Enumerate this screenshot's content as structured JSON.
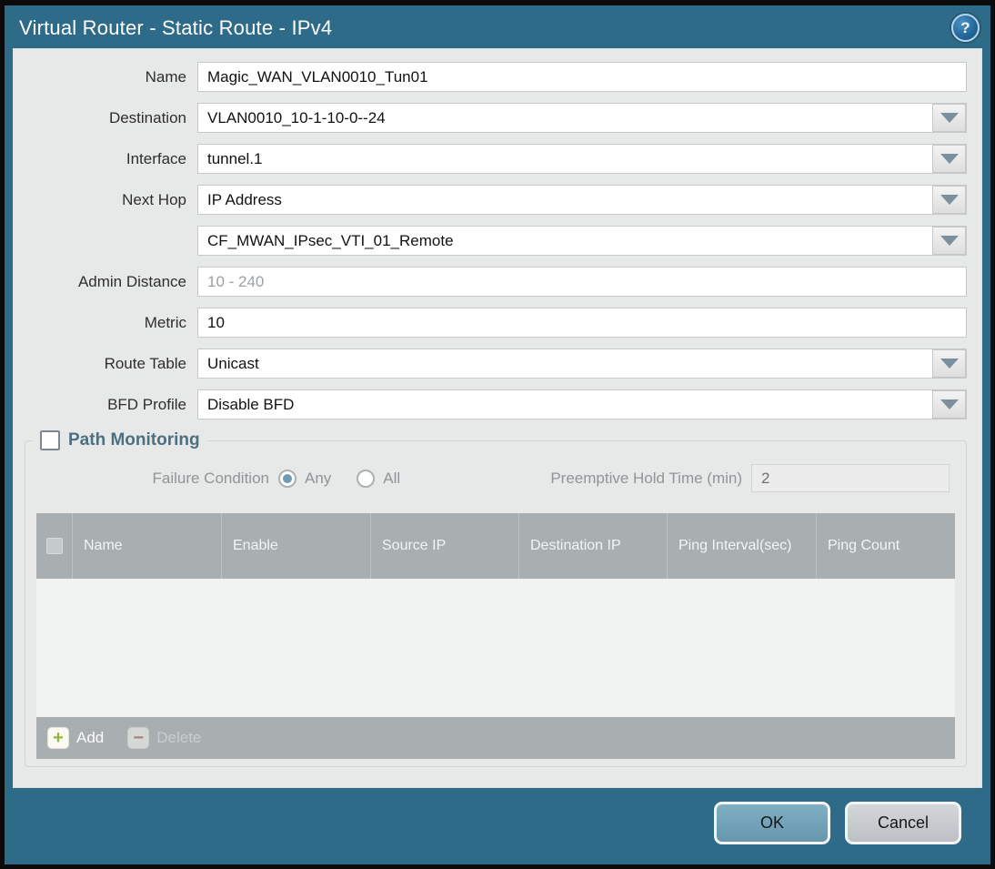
{
  "window": {
    "title": "Virtual Router - Static Route - IPv4",
    "help_icon": "?"
  },
  "form": {
    "rows": [
      {
        "label": "Name",
        "value": "Magic_WAN_VLAN0010_Tun01",
        "type": "text"
      },
      {
        "label": "Destination",
        "value": "VLAN0010_10-1-10-0--24",
        "type": "combo"
      },
      {
        "label": "Interface",
        "value": "tunnel.1",
        "type": "combo"
      },
      {
        "label": "Next Hop",
        "value": "IP Address",
        "type": "combo"
      },
      {
        "label": "",
        "value": "CF_MWAN_IPsec_VTI_01_Remote",
        "type": "combo"
      },
      {
        "label": "Admin Distance",
        "value": "",
        "placeholder": "10 - 240",
        "type": "text"
      },
      {
        "label": "Metric",
        "value": "10",
        "type": "text"
      },
      {
        "label": "Route Table",
        "value": "Unicast",
        "type": "combo"
      },
      {
        "label": "BFD Profile",
        "value": "Disable BFD",
        "type": "combo"
      }
    ]
  },
  "path_monitoring": {
    "title": "Path Monitoring",
    "enabled": false,
    "failure_condition_label": "Failure Condition",
    "options": [
      {
        "label": "Any",
        "selected": true
      },
      {
        "label": "All",
        "selected": false
      }
    ],
    "preemptive_label": "Preemptive Hold Time (min)",
    "preemptive_value": "2",
    "table": {
      "columns": [
        "Name",
        "Enable",
        "Source IP",
        "Destination IP",
        "Ping Interval(sec)",
        "Ping Count"
      ],
      "rows": []
    },
    "toolbar": {
      "add_label": "Add",
      "delete_label": "Delete"
    }
  },
  "footer": {
    "ok_label": "OK",
    "cancel_label": "Cancel"
  },
  "colors": {
    "frame_teal": "#2e6b88",
    "content_bg": "#e7e8e8",
    "table_header_gray": "#a9aeb1",
    "ok_button": "#6f9fb6",
    "cancel_button": "#c8ccd0",
    "pm_title": "#4d6f80",
    "radio_selected": "#6f9cb3",
    "add_plus_green": "#93b43d",
    "delete_minus_red": "#a8604e"
  }
}
